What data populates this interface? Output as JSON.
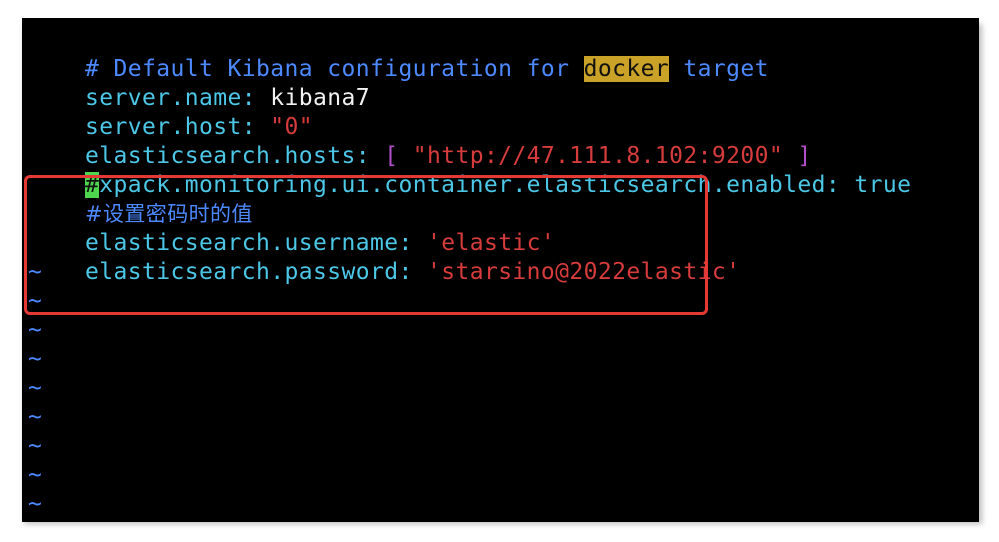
{
  "editor": {
    "lines": [
      {
        "kind": "comment",
        "prefix": "# Default Kibana configuration for ",
        "highlight": "docker",
        "suffix": " target"
      },
      {
        "kind": "kv",
        "key": "server.name",
        "sep": ": ",
        "value": "kibana7"
      },
      {
        "kind": "kv-str",
        "key": "server.host",
        "sep": ": ",
        "value": "\"0\""
      },
      {
        "kind": "kv-list",
        "key": "elasticsearch.hosts",
        "sep": ": ",
        "open": "[ ",
        "value": "\"http://47.111.8.102:9200\"",
        "close": " ]"
      },
      {
        "kind": "commented-kv",
        "cursor": "#",
        "key": "xpack.monitoring.ui.container.elasticsearch.enabled",
        "sep": ": ",
        "value": "true"
      },
      {
        "kind": "comment-only",
        "text": "#设置密码时的值"
      },
      {
        "kind": "kv-str",
        "key": "elasticsearch.username",
        "sep": ": ",
        "value": "'elastic'"
      },
      {
        "kind": "kv-str",
        "key": "elasticsearch.password",
        "sep": ": ",
        "value": "'starsino@2022elastic'"
      }
    ],
    "empty_line_marker": "~",
    "empty_line_count": 9
  },
  "colors": {
    "background": "#000000",
    "comment": "#4d89ff",
    "key": "#4cc7e6",
    "string": "#d63c3c",
    "annotation_box": "#e53935"
  }
}
